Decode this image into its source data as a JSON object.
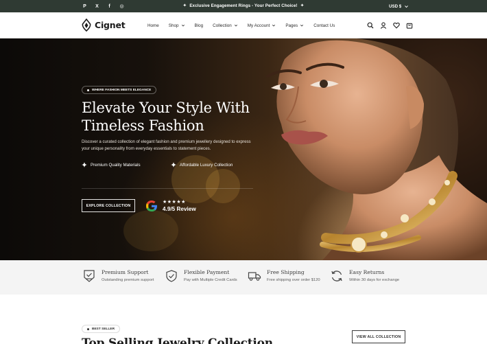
{
  "topbar": {
    "social": [
      {
        "icon": "pinterest-icon",
        "glyph": "P"
      },
      {
        "icon": "x-twitter-icon",
        "glyph": "X"
      },
      {
        "icon": "facebook-icon",
        "glyph": "f"
      },
      {
        "icon": "instagram-icon",
        "glyph": "◎"
      }
    ],
    "announcement": "Exclusive Engagement Rings - Your Perfect Choice!",
    "currency": "USD $"
  },
  "header": {
    "logo_text": "Cignet",
    "nav": [
      {
        "label": "Home",
        "dropdown": false
      },
      {
        "label": "Shop",
        "dropdown": true
      },
      {
        "label": "Blog",
        "dropdown": false
      },
      {
        "label": "Collection",
        "dropdown": true
      },
      {
        "label": "My Account",
        "dropdown": true
      },
      {
        "label": "Pages",
        "dropdown": true
      },
      {
        "label": "Contact Us",
        "dropdown": false
      }
    ],
    "icons": [
      "search-icon",
      "user-icon",
      "heart-icon",
      "cart-icon"
    ]
  },
  "hero": {
    "badge": "WHERE FASHION MEETS ELEGANCE",
    "title_line1": "Elevate Your Style With",
    "title_line2": "Timeless Fashion",
    "description": "Discover a curated collection of elegant fashion and premium jewellery designed to express your unique personality from everyday essentials to statement pieces.",
    "features": [
      "Premium Quality Materials",
      "Affordable Luxury Collection"
    ],
    "cta_label": "EXPLORE COLLECTION",
    "review_stars": "★★★★★",
    "review_text": "4.9/5 Review"
  },
  "services": [
    {
      "icon": "support-icon",
      "title": "Premium Support",
      "subtitle": "Outstanding premium support"
    },
    {
      "icon": "shield-check-icon",
      "title": "Flexible Payment",
      "subtitle": "Pay with Multiple Credit Cards"
    },
    {
      "icon": "truck-icon",
      "title": "Free Shipping",
      "subtitle": "Free shipping over order $120"
    },
    {
      "icon": "return-icon",
      "title": "Easy Returns",
      "subtitle": "Within 30 days for exchange"
    }
  ],
  "bestseller": {
    "badge": "BEST SELLER",
    "title": "Top Selling Jewelry Collection",
    "view_all_label": "VIEW ALL COLLECTION"
  },
  "colors": {
    "topbar_bg": "#2f3a33",
    "service_bg": "#f4f4f4",
    "text_dark": "#1c1c1c"
  }
}
